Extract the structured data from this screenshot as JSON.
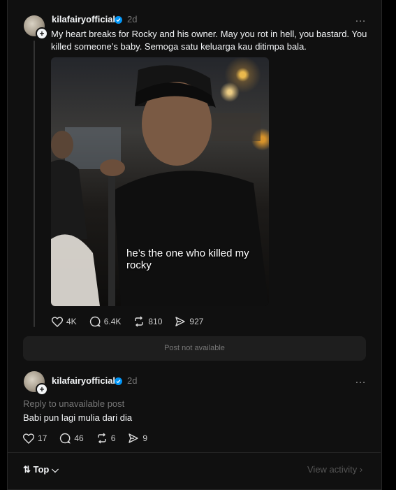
{
  "post": {
    "username": "kilafairyofficial",
    "time": "2d",
    "more": "…",
    "text": "My heart breaks for Rocky and his owner. May you rot in hell, you bastard. You killed someone’s baby. Semoga satu keluarga kau ditimpa bala.",
    "image_caption": "he’s the one who killed my rocky",
    "likes": "4K",
    "comments": "6.4K",
    "reposts": "810",
    "shares": "927"
  },
  "unavailable_label": "Post not available",
  "reply": {
    "username": "kilafairyofficial",
    "time": "2d",
    "more": "…",
    "reply_to": "Reply to unavailable post",
    "text": "Babi pun lagi mulia dari dia",
    "likes": "17",
    "comments": "46",
    "reposts": "6",
    "shares": "9"
  },
  "footer": {
    "sort_label": "⇅ Top ⌵",
    "view_activity": "View activity ›"
  },
  "colors": {
    "verified": "#0095f6",
    "background": "#101010"
  }
}
